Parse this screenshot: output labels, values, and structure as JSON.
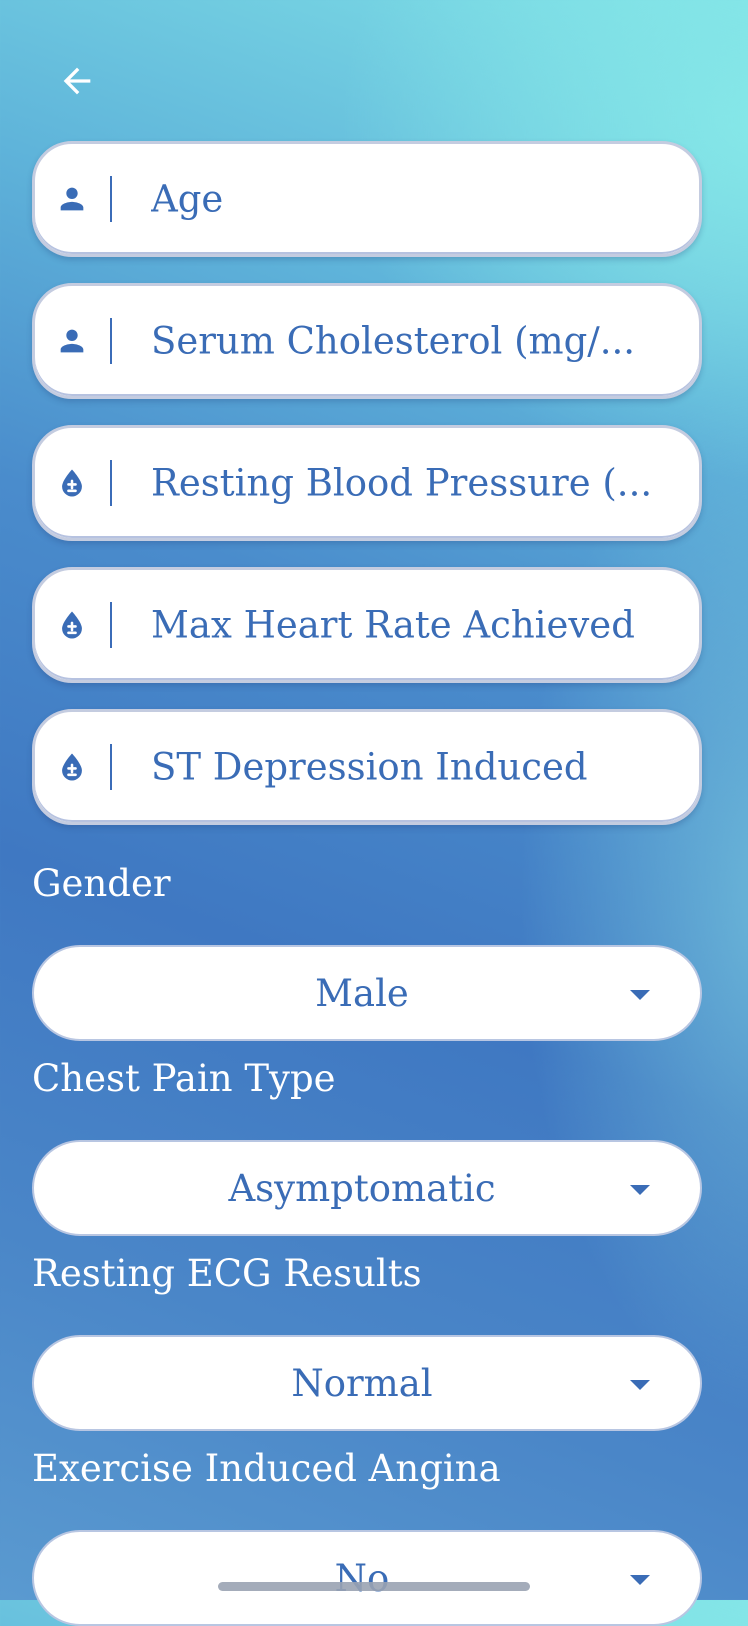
{
  "header": {
    "back_icon": "arrow-left-icon"
  },
  "fields": [
    {
      "icon": "person-icon",
      "placeholder": "Age"
    },
    {
      "icon": "person-icon",
      "placeholder": "Serum Cholesterol (mg/..."
    },
    {
      "icon": "blood-drop-icon",
      "placeholder": "Resting Blood Pressure (..."
    },
    {
      "icon": "blood-drop-icon",
      "placeholder": "Max Heart Rate Achieved"
    },
    {
      "icon": "blood-drop-icon",
      "placeholder": "ST Depression Induced"
    }
  ],
  "selects": [
    {
      "label": "Gender",
      "value": "Male"
    },
    {
      "label": "Chest Pain Type",
      "value": "Asymptomatic"
    },
    {
      "label": "Resting ECG Results",
      "value": "Normal"
    },
    {
      "label": "Exercise Induced Angina",
      "value": "No"
    }
  ],
  "colors": {
    "accent": "#3a6cb6",
    "background_top": "#86e8e8",
    "background_mid": "#3f78c2"
  }
}
